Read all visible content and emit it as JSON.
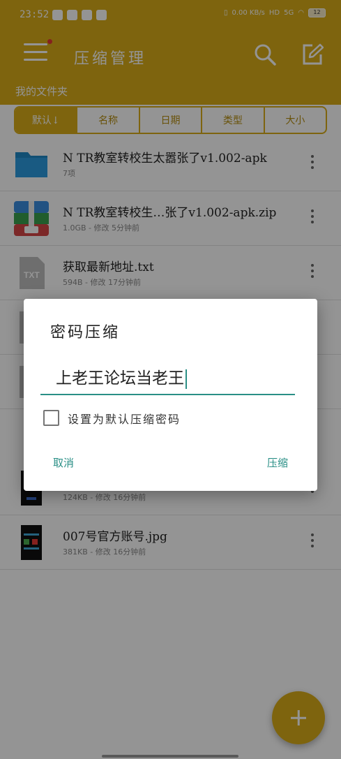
{
  "status_bar": {
    "time": "23:52",
    "network_speed": "0.00 KB/s",
    "hd_label": "HD",
    "signal_label": "5G",
    "battery_level": "12"
  },
  "app_bar": {
    "title": "压缩管理",
    "path_label": "我的文件夹",
    "icons": [
      "menu-icon",
      "search-icon",
      "edit-icon"
    ]
  },
  "sort_tabs": [
    "默认↓",
    "名称",
    "日期",
    "类型",
    "大小"
  ],
  "files": [
    {
      "name": "N TR教室转校生太嚣张了v1.002-apk",
      "meta": "7项",
      "icon": "folder-icon"
    },
    {
      "name": "N TR教室转校生…张了v1.002-apk.zip",
      "meta": "1.0GB - 修改 5分钟前",
      "icon": "zip-icon"
    },
    {
      "name": "获取最新地址.txt",
      "meta": "594B - 修改 17分钟前",
      "icon": "txt-icon"
    },
    {
      "name": "",
      "meta": "",
      "icon": "file-icon"
    },
    {
      "name": "",
      "meta": "",
      "icon": "file-icon"
    },
    {
      "name": "",
      "meta": "124KB - 修改 16分钟前",
      "icon": "image-thumbnail"
    },
    {
      "name": "007号官方账号.jpg",
      "meta": "381KB - 修改 16分钟前",
      "icon": "image-thumbnail"
    }
  ],
  "dialog": {
    "title": "密码压缩",
    "password_value": "上老王论坛当老王",
    "checkbox_label": "设置为默认压缩密码",
    "checkbox_checked": false,
    "cancel_label": "取消",
    "confirm_label": "压缩"
  },
  "colors": {
    "accent": "#d9ad19",
    "dialog_accent": "#2a8f86"
  }
}
